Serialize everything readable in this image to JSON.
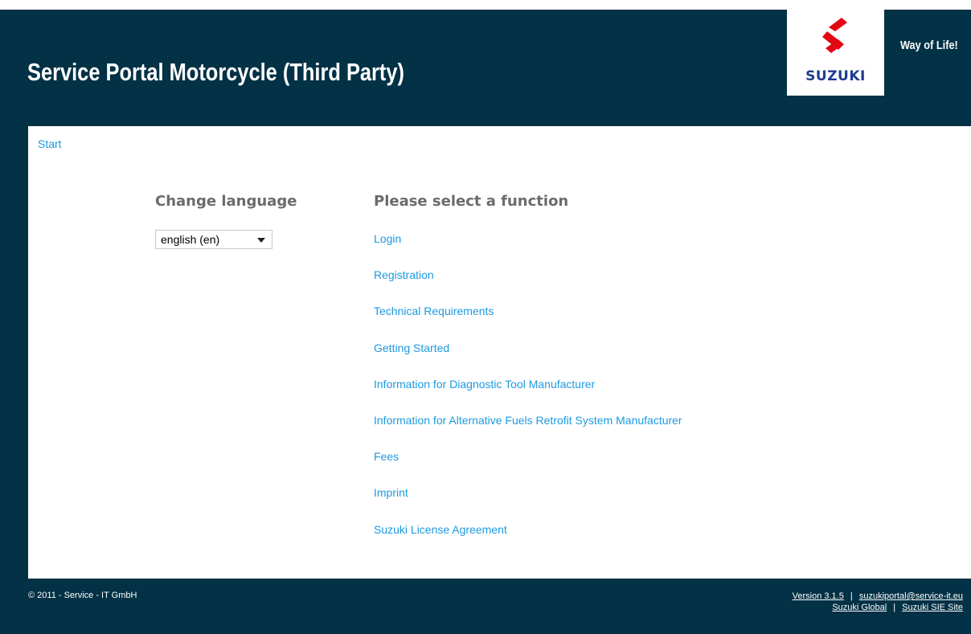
{
  "header": {
    "title": "Service Portal Motorcycle (Third Party)",
    "logo_text": "SUZUKI",
    "tagline": "Way of Life!"
  },
  "breadcrumb": {
    "start": "Start"
  },
  "language": {
    "heading": "Change language",
    "selected": "english (en)"
  },
  "functions": {
    "heading": "Please select a function",
    "items": [
      "Login",
      "Registration",
      "Technical Requirements",
      "Getting Started",
      "Information for Diagnostic Tool Manufacturer",
      "Information for Alternative Fuels Retrofit System Manufacturer",
      "Fees",
      "Imprint",
      "Suzuki License Agreement"
    ]
  },
  "footer": {
    "copyright": "© 2011 - Service - IT GmbH",
    "version": "Version 3.1.5",
    "email": "suzukiportal@service-it.eu",
    "suzuki_global": "Suzuki Global",
    "sie_site": "Suzuki SIE Site",
    "separator": "|"
  },
  "colors": {
    "header_bg": "#033145",
    "link": "#1e9ae0",
    "heading": "#6b6b6b",
    "logo_red": "#e30613",
    "logo_blue": "#1d3b90"
  }
}
